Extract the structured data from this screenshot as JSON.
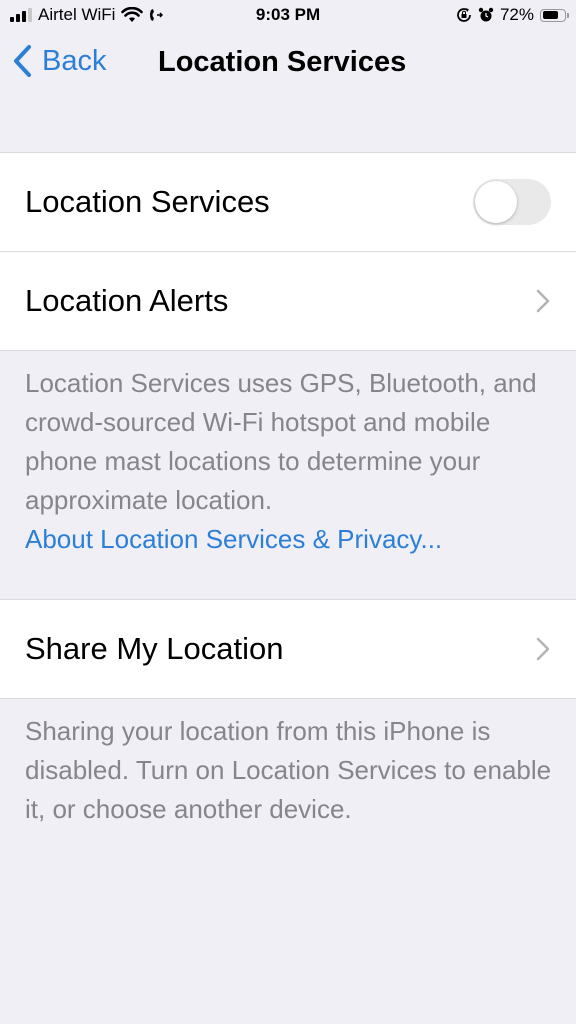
{
  "status_bar": {
    "carrier": "Airtel WiFi",
    "time": "9:03 PM",
    "battery_percent": "72%",
    "battery_level": 0.72,
    "icons": [
      "signal-icon",
      "wifi-icon",
      "call-forwarding-icon",
      "rotation-lock-icon",
      "alarm-icon",
      "battery-icon"
    ]
  },
  "nav": {
    "back_label": "Back",
    "title": "Location Services"
  },
  "group1": {
    "rows": [
      {
        "label": "Location Services",
        "control": "toggle",
        "toggle_on": false
      },
      {
        "label": "Location Alerts",
        "control": "chevron"
      }
    ],
    "footer_text": "Location Services uses GPS, Bluetooth, and crowd-sourced Wi-Fi hotspot and mobile phone mast locations to determine your approximate location.",
    "footer_link": "About Location Services & Privacy..."
  },
  "group2": {
    "rows": [
      {
        "label": "Share My Location",
        "control": "chevron"
      }
    ],
    "footer_text": "Sharing your location from this iPhone is disabled. Turn on Location Services to enable it, or choose another device."
  },
  "colors": {
    "accent": "#2c7fd6",
    "background": "#f0eff6",
    "footer_text": "#86858b",
    "toggle_off": "#e9e9ea"
  }
}
